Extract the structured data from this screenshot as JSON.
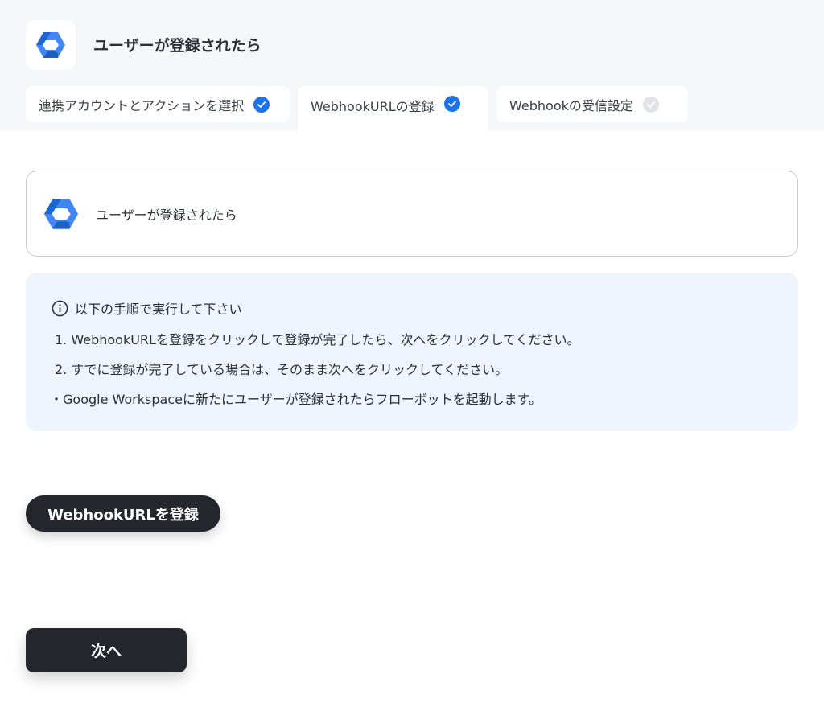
{
  "header": {
    "title": "ユーザーが登録されたら",
    "app_icon": "google-workspace-hexagon-icon"
  },
  "tabs": [
    {
      "label": "連携アカウントとアクションを選択",
      "status": "done"
    },
    {
      "label": "WebhookURLの登録",
      "status": "done",
      "active": true
    },
    {
      "label": "Webhookの受信設定",
      "status": "pending"
    }
  ],
  "trigger_card": {
    "label": "ユーザーが登録されたら",
    "icon": "google-workspace-hexagon-icon"
  },
  "instructions": {
    "heading": "以下の手順で実行して下さい",
    "steps": [
      "1. WebhookURLを登録をクリックして登録が完了したら、次へをクリックしてください。",
      "2. すでに登録が完了している場合は、そのまま次へをクリックしてください。"
    ],
    "note": "・Google Workspaceに新たにユーザーが登録されたらフローボットを起動します。"
  },
  "buttons": {
    "register_label": "WebhookURLを登録",
    "next_label": "次へ"
  },
  "colors": {
    "accent": "#1a73e8",
    "button_dark": "#24272d",
    "info_bg": "#eef5fe",
    "header_bg": "#f5f6f8"
  }
}
